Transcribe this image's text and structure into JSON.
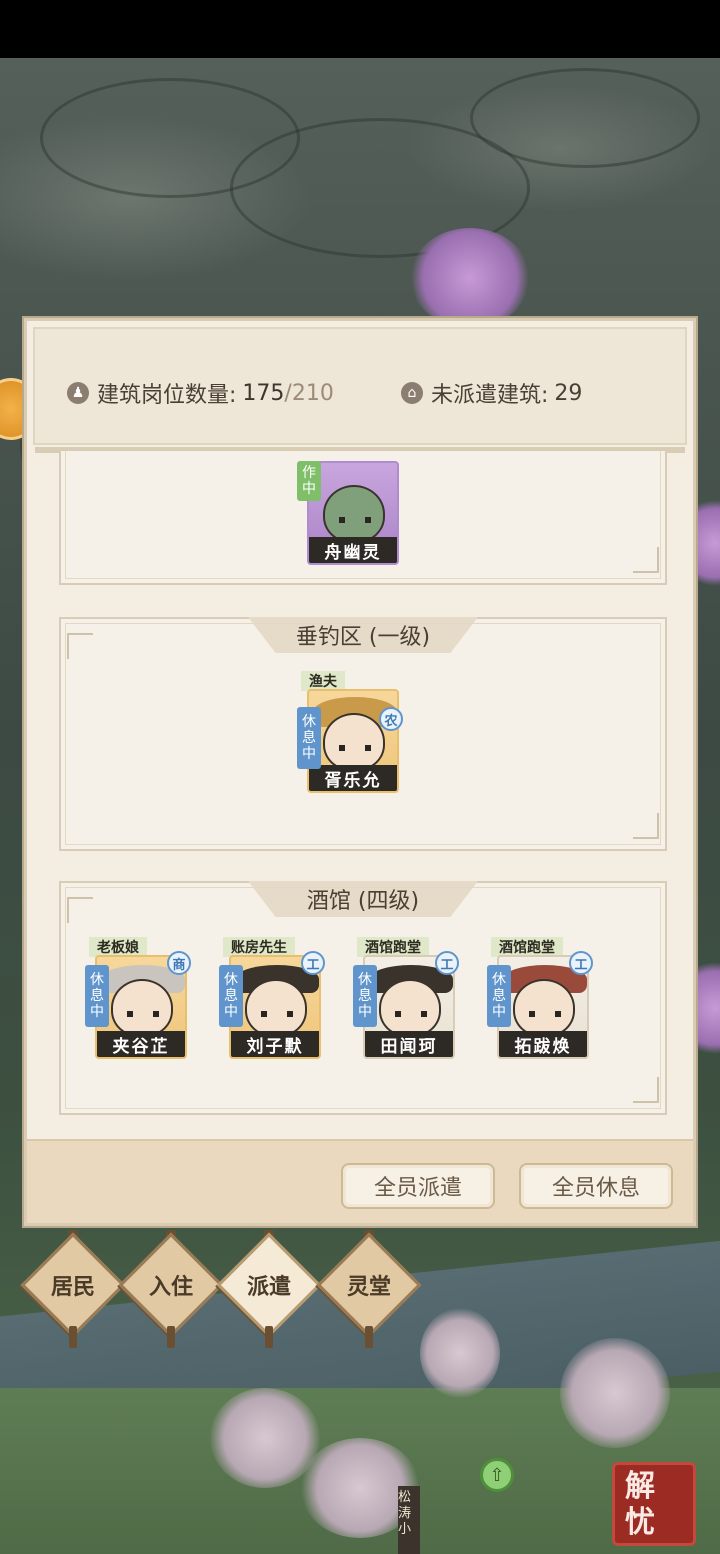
{
  "header": {
    "slots_label": "建筑岗位数量:",
    "slots_used": "175",
    "slots_sep": "/",
    "slots_total": "210",
    "undispatched_label": "未派遣建筑:",
    "undispatched_count": "29"
  },
  "sections": [
    {
      "title": "",
      "workers": [
        {
          "role": "",
          "status": "作中",
          "name": "舟幽灵",
          "trait": ""
        }
      ]
    },
    {
      "title": "垂钓区 (一级)",
      "workers": [
        {
          "role": "渔夫",
          "status": "休息中",
          "name": "胥乐允",
          "trait": "农"
        }
      ]
    },
    {
      "title": "酒馆 (四级)",
      "workers": [
        {
          "role": "老板娘",
          "status": "休息中",
          "name": "夹谷芷",
          "trait": "商"
        },
        {
          "role": "账房先生",
          "status": "休息中",
          "name": "刘子默",
          "trait": "工"
        },
        {
          "role": "酒馆跑堂",
          "status": "休息中",
          "name": "田闻珂",
          "trait": "工"
        },
        {
          "role": "酒馆跑堂",
          "status": "休息中",
          "name": "拓跋焕",
          "trait": "工"
        }
      ]
    }
  ],
  "footer": {
    "dispatch_all": "全员派遣",
    "rest_all": "全员休息"
  },
  "tabs": [
    {
      "label": "居民",
      "active": false
    },
    {
      "label": "入住",
      "active": false
    },
    {
      "label": "派遣",
      "active": true
    },
    {
      "label": "灵堂",
      "active": false
    }
  ],
  "map": {
    "signpost": "松涛小",
    "relieve_button": "解忧"
  },
  "icons": {
    "slots": "person-icon",
    "undispatched": "building-icon",
    "guide": "upgrade-arrow-icon"
  },
  "colors": {
    "panel_bg": "#f3ede2",
    "rest_status": "#5f95cc",
    "work_status": "#7fbf6a",
    "gold_frame": "#eec57a",
    "purple_frame": "#a982c6",
    "relieve_red": "#9b2b23"
  }
}
